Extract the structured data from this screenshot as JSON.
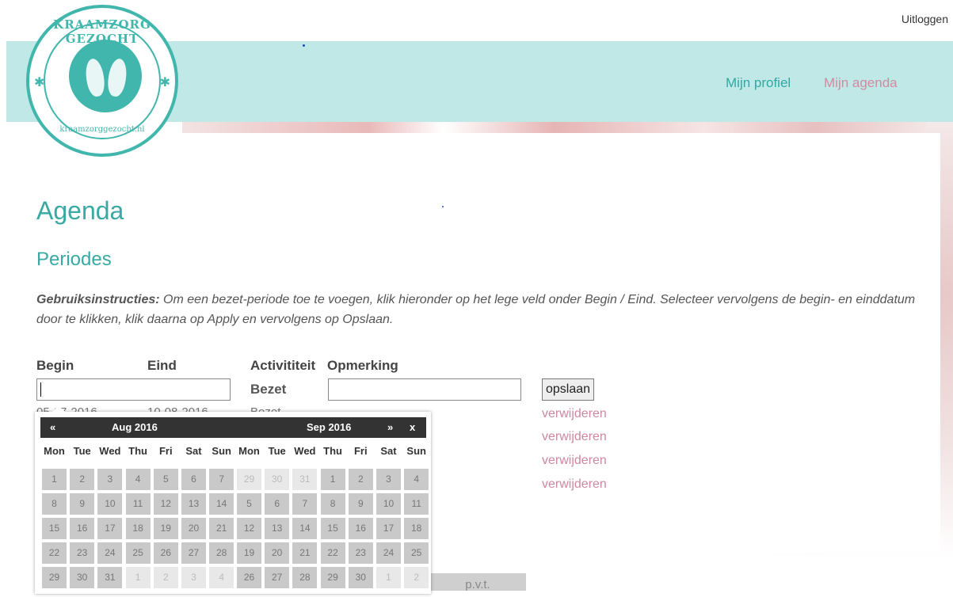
{
  "topbar": {
    "logout": "Uitloggen"
  },
  "logo": {
    "top_text": "KRAAMZORG GEZOCHT",
    "bottom_text": "kraamzorggezocht.nl"
  },
  "nav": {
    "profile": "Mijn profiel",
    "agenda": "Mijn agenda"
  },
  "page": {
    "title": "Agenda",
    "subtitle": "Periodes",
    "instructions_label": "Gebruiksinstructies:",
    "instructions_text": " Om een bezet-periode toe te voegen, klik hieronder op het lege veld onder Begin / Eind. Selecteer vervolgens de begin- en einddatum door te klikken, klik daarna op Apply en vervolgens op Opslaan."
  },
  "table": {
    "headers": {
      "begin": "Begin",
      "eind": "Eind",
      "activiteit": "Activititeit",
      "opmerking": "Opmerking"
    },
    "new_row": {
      "activity": "Bezet",
      "save_label": "opslaan"
    },
    "first_row_partial": {
      "begin": "05-07-2016",
      "eind": "10-08-2016",
      "activity": "Bezet"
    },
    "delete_label": "verwijderen",
    "delete_count": 4
  },
  "datepicker": {
    "prev": "«",
    "next": "»",
    "close": "x",
    "month_left": "Aug 2016",
    "month_right": "Sep 2016",
    "weekdays": [
      "Mon",
      "Tue",
      "Wed",
      "Thu",
      "Fri",
      "Sat",
      "Sun"
    ],
    "left_weeks": [
      [
        [
          "1",
          0
        ],
        [
          "2",
          0
        ],
        [
          "3",
          0
        ],
        [
          "4",
          0
        ],
        [
          "5",
          0
        ],
        [
          "6",
          0
        ],
        [
          "7",
          0
        ]
      ],
      [
        [
          "8",
          0
        ],
        [
          "9",
          0
        ],
        [
          "10",
          0
        ],
        [
          "11",
          0
        ],
        [
          "12",
          0
        ],
        [
          "13",
          0
        ],
        [
          "14",
          0
        ]
      ],
      [
        [
          "15",
          0
        ],
        [
          "16",
          0
        ],
        [
          "17",
          0
        ],
        [
          "18",
          0
        ],
        [
          "19",
          0
        ],
        [
          "20",
          0
        ],
        [
          "21",
          0
        ]
      ],
      [
        [
          "22",
          0
        ],
        [
          "23",
          0
        ],
        [
          "24",
          0
        ],
        [
          "25",
          0
        ],
        [
          "26",
          0
        ],
        [
          "27",
          0
        ],
        [
          "28",
          0
        ]
      ],
      [
        [
          "29",
          0
        ],
        [
          "30",
          0
        ],
        [
          "31",
          0
        ],
        [
          "1",
          1
        ],
        [
          "2",
          1
        ],
        [
          "3",
          1
        ],
        [
          "4",
          1
        ]
      ]
    ],
    "right_weeks": [
      [
        [
          "29",
          1
        ],
        [
          "30",
          1
        ],
        [
          "31",
          1
        ],
        [
          "1",
          0
        ],
        [
          "2",
          0
        ],
        [
          "3",
          0
        ],
        [
          "4",
          0
        ]
      ],
      [
        [
          "5",
          0
        ],
        [
          "6",
          0
        ],
        [
          "7",
          0
        ],
        [
          "8",
          0
        ],
        [
          "9",
          0
        ],
        [
          "10",
          0
        ],
        [
          "11",
          0
        ]
      ],
      [
        [
          "12",
          0
        ],
        [
          "13",
          0
        ],
        [
          "14",
          0
        ],
        [
          "15",
          0
        ],
        [
          "16",
          0
        ],
        [
          "17",
          0
        ],
        [
          "18",
          0
        ]
      ],
      [
        [
          "19",
          0
        ],
        [
          "20",
          0
        ],
        [
          "21",
          0
        ],
        [
          "22",
          0
        ],
        [
          "23",
          0
        ],
        [
          "24",
          0
        ],
        [
          "25",
          0
        ]
      ],
      [
        [
          "26",
          0
        ],
        [
          "27",
          0
        ],
        [
          "28",
          0
        ],
        [
          "29",
          0
        ],
        [
          "30",
          0
        ],
        [
          "1",
          1
        ],
        [
          "2",
          1
        ]
      ]
    ]
  },
  "partial_button": "p.v.t."
}
